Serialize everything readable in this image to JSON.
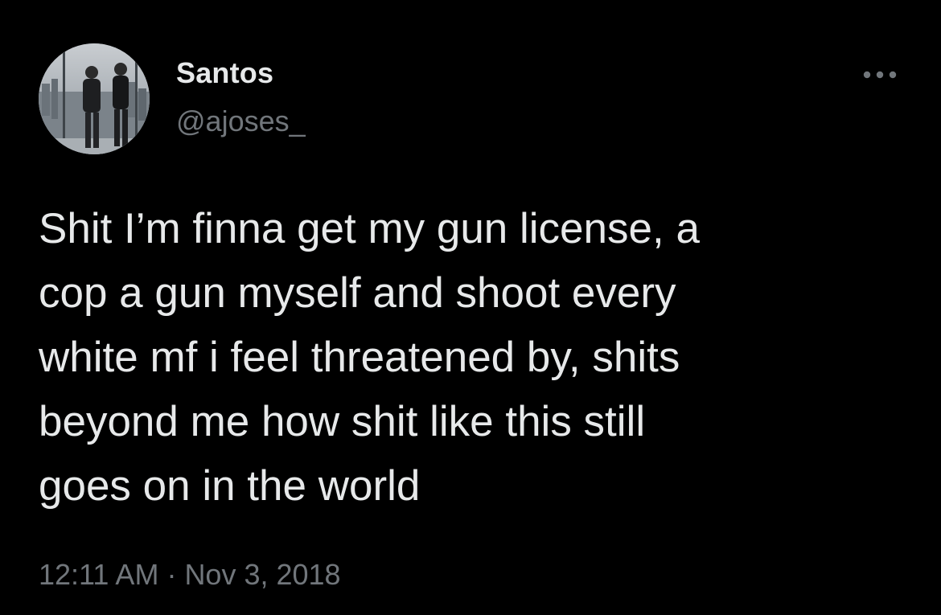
{
  "tweet": {
    "author": {
      "display_name": "Santos",
      "handle": "@ajoses_",
      "avatar_icon": "profile-photo"
    },
    "more_icon": "more-options-icon",
    "text": "Shit I’m finna get my gun license, a\ncop a gun myself and shoot every\nwhite mf i feel threatened by, shits\nbeyond me how shit like this still\ngoes on in the world",
    "time": "12:11 AM",
    "separator": "·",
    "date": "Nov 3, 2018"
  },
  "colors": {
    "background": "#000000",
    "primary_text": "#e7e9ea",
    "secondary_text": "#71767b"
  }
}
